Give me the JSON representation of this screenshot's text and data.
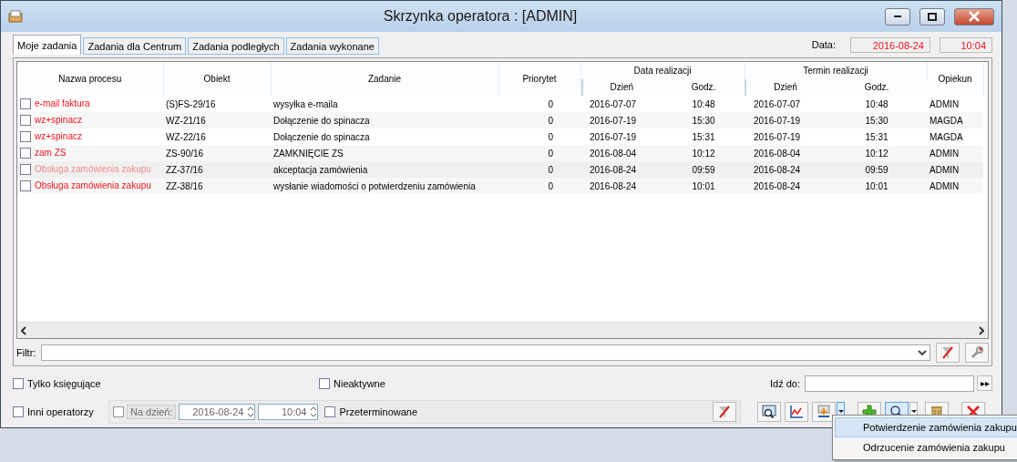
{
  "window": {
    "title": "Skrzynka operatora : [ADMIN]"
  },
  "tabs": [
    {
      "label": "Moje zadania",
      "selected": true
    },
    {
      "label": "Zadania dla Centrum",
      "selected": false
    },
    {
      "label": "Zadania podległych",
      "selected": false
    },
    {
      "label": "Zadania wykonane",
      "selected": false
    }
  ],
  "date": {
    "label": "Data:",
    "day": "2016-08-24",
    "time": "10:04"
  },
  "table": {
    "column_groups": [
      {
        "label": "Data realizacji"
      },
      {
        "label": "Termin realizacji"
      }
    ],
    "columns": [
      {
        "label": "Nazwa procesu"
      },
      {
        "label": "Obiekt"
      },
      {
        "label": "Zadanie"
      },
      {
        "label": "Priorytet"
      },
      {
        "label": "Dzień",
        "group_start": true
      },
      {
        "label": "Godz.",
        "group_start": false
      },
      {
        "label": "Dzień",
        "group_start": true
      },
      {
        "label": "Godz.",
        "group_start": false
      },
      {
        "label": "Opiekun"
      }
    ],
    "rows": [
      {
        "checked": false,
        "selected": false,
        "cells": [
          "e-mail faktura",
          "(S)FS-29/16",
          "wysyłka e-maila",
          "0",
          "2016-07-07",
          "10:48",
          "2016-07-07",
          "10:48",
          "ADMIN"
        ]
      },
      {
        "checked": false,
        "selected": false,
        "cells": [
          "wz+spinacz",
          "WZ-21/16",
          "Dołączenie do spinacza",
          "0",
          "2016-07-19",
          "15:30",
          "2016-07-19",
          "15:30",
          "MAGDA"
        ]
      },
      {
        "checked": false,
        "selected": false,
        "cells": [
          "wz+spinacz",
          "WZ-22/16",
          "Dołączenie do spinacza",
          "0",
          "2016-07-19",
          "15:31",
          "2016-07-19",
          "15:31",
          "MAGDA"
        ]
      },
      {
        "checked": false,
        "selected": false,
        "cells": [
          "zam ZS",
          "ZS-90/16",
          "ZAMKNIĘCIE ZS",
          "0",
          "2016-08-04",
          "10:12",
          "2016-08-04",
          "10:12",
          "ADMIN"
        ]
      },
      {
        "checked": false,
        "selected": true,
        "cells": [
          "Obsługa zamówienia zakupu",
          "ZZ-37/16",
          "akceptacja zamówienia",
          "0",
          "2016-08-24",
          "09:59",
          "2016-08-24",
          "09:59",
          "ADMIN"
        ]
      },
      {
        "checked": false,
        "selected": false,
        "cells": [
          "Obsługa zamówienia zakupu",
          "ZZ-38/16",
          "wysłanie wiadomości o potwierdzeniu zamówienia",
          "0",
          "2016-08-24",
          "10:01",
          "2016-08-24",
          "10:01",
          "ADMIN"
        ]
      }
    ]
  },
  "filter": {
    "label": "Filtr:"
  },
  "options": {
    "only_posting": {
      "label": "Tylko księgujące",
      "checked": false
    },
    "inactive": {
      "label": "Nieaktywne",
      "checked": false
    },
    "other_operators": {
      "label": "Inni operatorzy",
      "checked": false
    },
    "overdue": {
      "label": "Przeterminowane",
      "checked": false
    }
  },
  "on_day": {
    "checked": false,
    "disabled": true,
    "label": "Na dzień:",
    "day": "2016-08-24",
    "time": "10:04"
  },
  "goto": {
    "label": "Idź do:",
    "button": "▸▸"
  },
  "menu": [
    {
      "label": "Potwierdzenie zamówienia zakupu",
      "selected": true
    },
    {
      "label": "Odrzucenie zamówienia zakupu",
      "selected": false
    }
  ]
}
